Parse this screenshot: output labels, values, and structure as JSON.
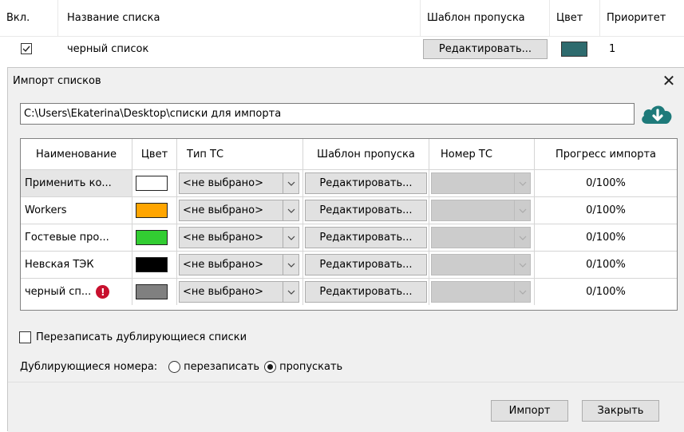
{
  "background_table": {
    "headers": [
      "Вкл.",
      "Название списка",
      "Шаблон пропуска",
      "Цвет",
      "Приоритет"
    ],
    "row": {
      "checked": true,
      "name": "черный список",
      "template_button": "Редактировать...",
      "color": "#2e6b6e",
      "priority": "1"
    }
  },
  "dialog": {
    "title": "Импорт списков",
    "path": "C:\\Users\\Ekaterina\\Desktop\\списки для импорта",
    "upload_icon": "cloud-download-icon",
    "upload_icon_color": "#1e7a7a",
    "columns": [
      "Наименование",
      "Цвет",
      "Тип ТС",
      "Шаблон пропуска",
      "Номер ТС",
      "Прогресс импорта"
    ],
    "rows": [
      {
        "name": "Применить ко...",
        "color": "#ffffff",
        "type": "<не выбрано>",
        "template": "Редактировать...",
        "progress": "0/100%",
        "warning": false
      },
      {
        "name": "Workers",
        "color": "#ffa500",
        "type": "<не выбрано>",
        "template": "Редактировать...",
        "progress": "0/100%",
        "warning": false
      },
      {
        "name": "Гостевые про...",
        "color": "#32cd32",
        "type": "<не выбрано>",
        "template": "Редактировать...",
        "progress": "0/100%",
        "warning": false
      },
      {
        "name": "Невская ТЭК",
        "color": "#000000",
        "type": "<не выбрано>",
        "template": "Редактировать...",
        "progress": "0/100%",
        "warning": false
      },
      {
        "name": "черный сп...",
        "color": "#808080",
        "type": "<не выбрано>",
        "template": "Редактировать...",
        "progress": "0/100%",
        "warning": true
      }
    ],
    "overwrite_label": "Перезаписать дублирующиеся списки",
    "overwrite_checked": false,
    "duplicates_label": "Дублирующиеся номера:",
    "duplicates_options": [
      "перезаписать",
      "пропускать"
    ],
    "duplicates_selected": "пропускать",
    "import_button": "Импорт",
    "close_button": "Закрыть"
  }
}
